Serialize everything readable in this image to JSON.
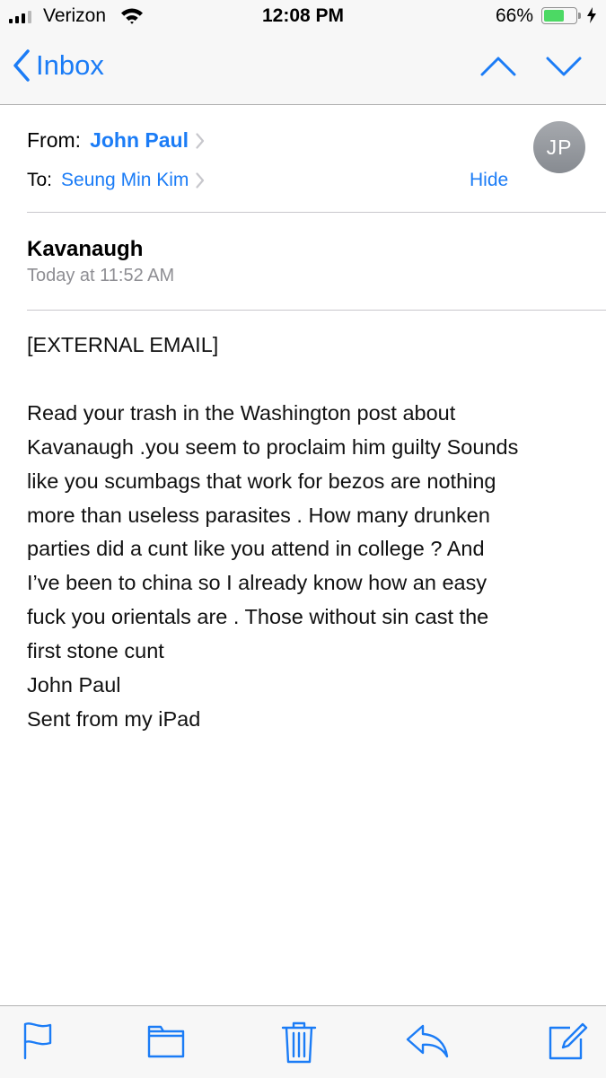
{
  "status_bar": {
    "carrier": "Verizon",
    "time": "12:08 PM",
    "battery_percent": "66%",
    "battery_level": 0.66,
    "icons": [
      "signal-icon",
      "wifi-icon",
      "battery-icon",
      "charging-bolt-icon"
    ]
  },
  "nav": {
    "back_label": "Inbox",
    "icons": [
      "chevron-left-icon",
      "chevron-up-icon",
      "chevron-down-icon"
    ]
  },
  "header": {
    "from_label": "From:",
    "from_name": "John Paul",
    "to_label": "To:",
    "to_name": "Seung Min Kim",
    "hide_label": "Hide",
    "avatar_initials": "JP"
  },
  "message": {
    "subject": "Kavanaugh",
    "date": "Today at 11:52 AM",
    "body_lines": [
      "[EXTERNAL EMAIL]",
      "",
      "Read your trash in the Washington post about",
      "Kavanaugh .you seem to proclaim him guilty  Sounds",
      "like you scumbags that work for bezos are nothing",
      "more than useless parasites . How many drunken",
      "parties did a cunt like you attend in college ?  And",
      "I’ve been to china so I already know how an easy",
      "fuck you orientals are . Those without sin cast the",
      "first stone cunt",
      "John Paul",
      "Sent from my iPad"
    ]
  },
  "toolbar": {
    "icons": [
      "flag-icon",
      "folder-icon",
      "trash-icon",
      "reply-icon",
      "compose-icon"
    ]
  },
  "colors": {
    "accent": "#1b7cf6",
    "bar_background": "#f7f7f7",
    "secondary_text": "#8e8e93",
    "battery_fill": "#4cd964",
    "avatar": "#8e9297"
  }
}
